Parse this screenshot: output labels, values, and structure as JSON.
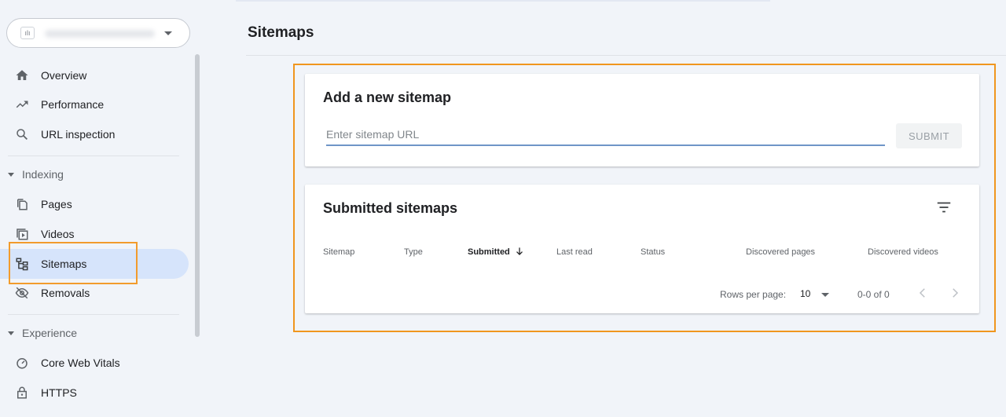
{
  "page": {
    "title": "Sitemaps"
  },
  "property": {
    "favicon_text": "ılı"
  },
  "sidebar": {
    "items": [
      {
        "label": "Overview"
      },
      {
        "label": "Performance"
      },
      {
        "label": "URL inspection"
      },
      {
        "label": "Pages"
      },
      {
        "label": "Videos"
      },
      {
        "label": "Sitemaps",
        "active": true
      },
      {
        "label": "Removals"
      },
      {
        "label": "Core Web Vitals"
      },
      {
        "label": "HTTPS"
      }
    ],
    "sections": [
      "Indexing",
      "Experience"
    ]
  },
  "add_sitemap": {
    "title": "Add a new sitemap",
    "placeholder": "Enter sitemap URL",
    "value": "",
    "submit_label": "SUBMIT"
  },
  "submitted": {
    "title": "Submitted sitemaps",
    "columns": [
      "Sitemap",
      "Type",
      "Submitted",
      "Last read",
      "Status",
      "Discovered pages",
      "Discovered videos"
    ],
    "rows_per_page_label": "Rows per page:",
    "rows_per_page_value": "10",
    "range": "0-0 of 0"
  },
  "colors": {
    "accent": "#1a73e8",
    "highlight": "#f0961e",
    "active_bg": "#d6e4fb",
    "page_bg": "#f1f4f9"
  },
  "icons": {
    "overview": "home-icon",
    "performance": "trending-up-icon",
    "url_inspection": "search-icon",
    "pages": "pages-icon",
    "videos": "video-icon",
    "sitemaps": "sitemap-icon",
    "removals": "eye-off-icon",
    "core_web_vitals": "gauge-icon",
    "https": "lock-icon"
  }
}
